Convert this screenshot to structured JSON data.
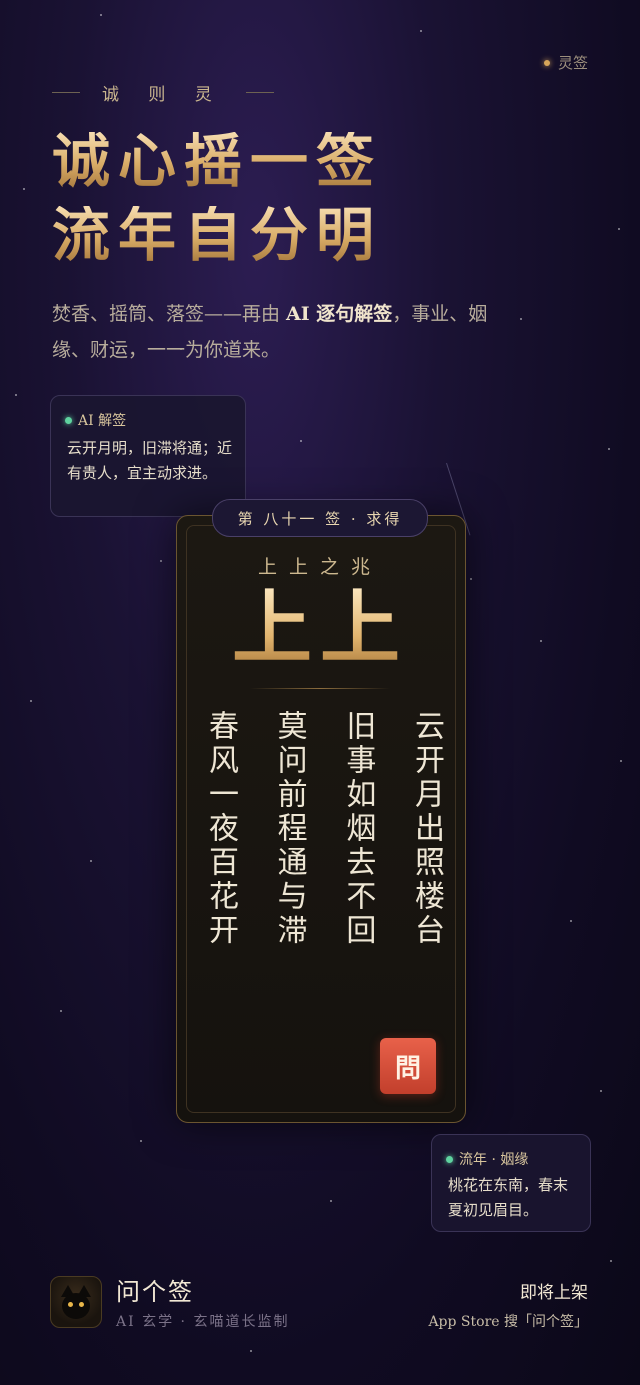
{
  "top_tag": {
    "label": "灵签"
  },
  "motto": "诚 则 灵",
  "headline": {
    "line1": "诚心摇一签",
    "line2": "流年自分明"
  },
  "description": {
    "part1": "焚香、摇筒、落签——再由 ",
    "highlight": "AI 逐句解签",
    "part2": "，事业、姻缘、财运，一一为你道来。"
  },
  "ai_bubble": {
    "title": "AI 解签",
    "body": "云开月明，旧滞将通；近有贵人，宜主动求进。"
  },
  "fortune": {
    "badge": "第 八十一 签 · 求得",
    "omen": "上上之兆",
    "rank": "上上",
    "poem_columns": [
      "春风一夜百花开",
      "莫问前程通与滞",
      "旧事如烟去不回",
      "云开月出照楼台"
    ],
    "seal": "問"
  },
  "year_bubble": {
    "title": "流年 · 姻缘",
    "body": "桃花在东南，春末夏初见眉目。"
  },
  "footer": {
    "app_name": "问个签",
    "app_subtitle": "AI 玄学 · 玄喵道长监制",
    "release_title": "即将上架",
    "release_sub": "App Store 搜「问个签」"
  },
  "colors": {
    "gold": "#d9ac67",
    "seal_red": "#d24e37",
    "accent_green": "#5fd3a0",
    "background": "#140e28"
  }
}
